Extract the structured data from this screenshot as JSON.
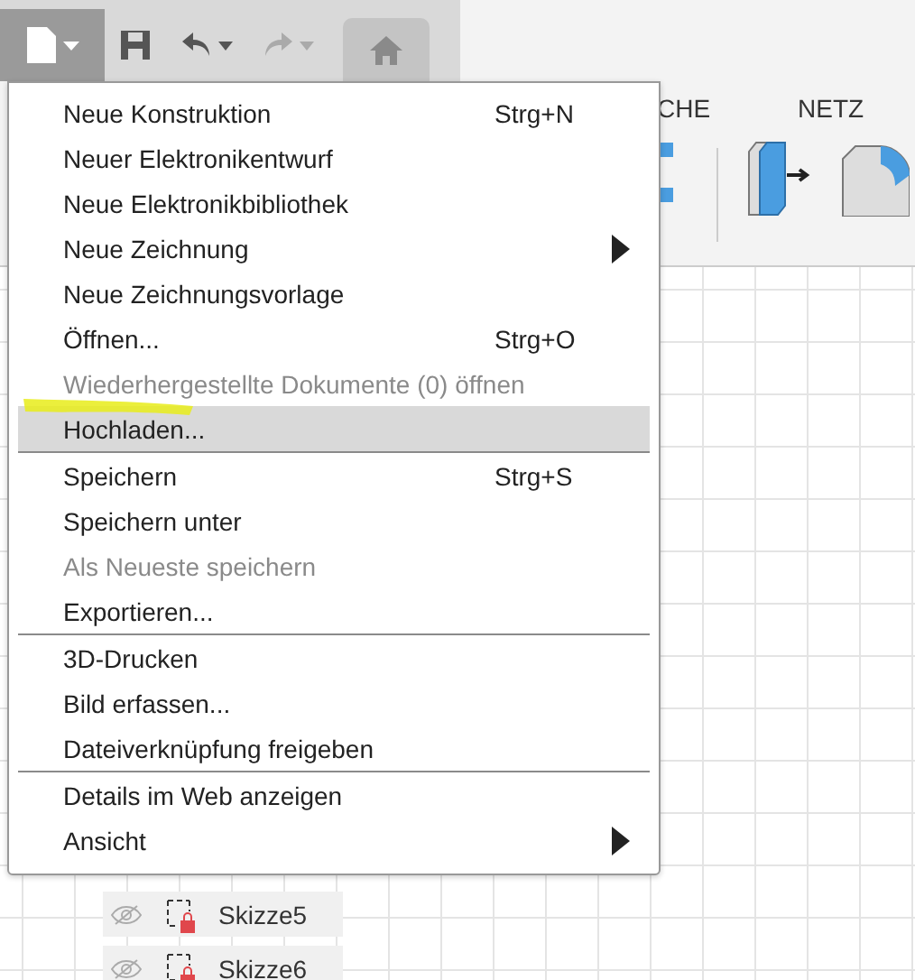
{
  "ribbon": {
    "tabs": [
      {
        "label": "CHE"
      },
      {
        "label": "NETZ"
      }
    ]
  },
  "menu": {
    "groups": [
      [
        {
          "label": "Neue Konstruktion",
          "shortcut": "Strg+N",
          "disabled": false,
          "selected": false,
          "submenu": false
        },
        {
          "label": "Neuer Elektronikentwurf",
          "disabled": false,
          "selected": false,
          "submenu": false
        },
        {
          "label": "Neue Elektronikbibliothek",
          "disabled": false,
          "selected": false,
          "submenu": false
        },
        {
          "label": "Neue Zeichnung",
          "disabled": false,
          "selected": false,
          "submenu": true
        },
        {
          "label": "Neue Zeichnungsvorlage",
          "disabled": false,
          "selected": false,
          "submenu": false
        },
        {
          "label": "Öffnen...",
          "shortcut": "Strg+O",
          "disabled": false,
          "selected": false,
          "submenu": false
        },
        {
          "label": "Wiederhergestellte Dokumente (0) öffnen",
          "disabled": true,
          "selected": false,
          "submenu": false
        },
        {
          "label": "Hochladen...",
          "disabled": false,
          "selected": true,
          "submenu": false
        }
      ],
      [
        {
          "label": "Speichern",
          "shortcut": "Strg+S",
          "disabled": false,
          "selected": false,
          "submenu": false
        },
        {
          "label": "Speichern unter",
          "disabled": false,
          "selected": false,
          "submenu": false
        },
        {
          "label": "Als Neueste speichern",
          "disabled": true,
          "selected": false,
          "submenu": false
        },
        {
          "label": "Exportieren...",
          "disabled": false,
          "selected": false,
          "submenu": false
        }
      ],
      [
        {
          "label": "3D-Drucken",
          "disabled": false,
          "selected": false,
          "submenu": false
        },
        {
          "label": "Bild erfassen...",
          "disabled": false,
          "selected": false,
          "submenu": false
        },
        {
          "label": "Dateiverknüpfung freigeben",
          "disabled": false,
          "selected": false,
          "submenu": false
        }
      ],
      [
        {
          "label": "Details im Web anzeigen",
          "disabled": false,
          "selected": false,
          "submenu": false
        },
        {
          "label": "Ansicht",
          "disabled": false,
          "selected": false,
          "submenu": true
        }
      ]
    ]
  },
  "browser": {
    "rows": [
      {
        "label": "Skizze5"
      },
      {
        "label": "Skizze6"
      }
    ]
  }
}
